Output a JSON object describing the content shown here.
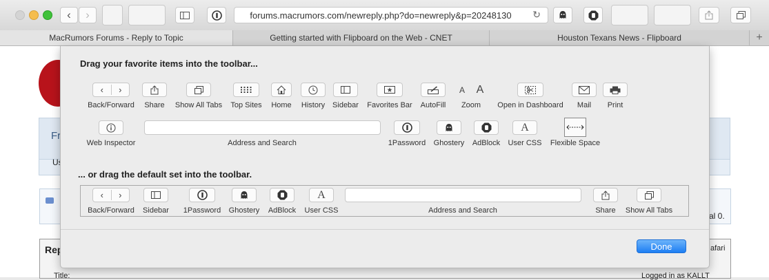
{
  "browser": {
    "url": "forums.macrumors.com/newreply.php?do=newreply&p=20248130",
    "tabs": [
      {
        "label": "MacRumors Forums - Reply to Topic",
        "active": true
      },
      {
        "label": "Getting started with Flipboard on the Web - CNET",
        "active": false
      },
      {
        "label": "Houston Texans News - Flipboard",
        "active": false
      }
    ],
    "back_glyph": "‹",
    "forward_glyph": "›",
    "reload_glyph": "↻",
    "new_tab_glyph": "+"
  },
  "background_page": {
    "fragment_1": "Fr",
    "fragment_2": "Us",
    "fragment_3": "al 0.",
    "fragment_4": "Rep",
    "fragment_5": "afari",
    "fragment_6": "Title:",
    "fragment_7": "Logged in as KALLT"
  },
  "sheet": {
    "favorites_heading": "Drag your favorite items into the toolbar...",
    "default_heading": "... or drag the default set into the toolbar.",
    "done_label": "Done",
    "favorites": {
      "back_forward": "Back/Forward",
      "share": "Share",
      "show_all_tabs": "Show All Tabs",
      "top_sites": "Top Sites",
      "home": "Home",
      "history": "History",
      "sidebar": "Sidebar",
      "favorites_bar": "Favorites Bar",
      "autofill": "AutoFill",
      "zoom": "Zoom",
      "open_in_dashboard": "Open in Dashboard",
      "mail": "Mail",
      "print": "Print",
      "web_inspector": "Web Inspector",
      "address_and_search": "Address and Search",
      "onepassword": "1Password",
      "ghostery": "Ghostery",
      "adblock": "AdBlock",
      "user_css": "User CSS",
      "flexible_space": "Flexible Space"
    },
    "zoom_small_glyph": "A",
    "zoom_large_glyph": "A",
    "user_css_glyph": "A",
    "default_set": {
      "back_forward": "Back/Forward",
      "sidebar": "Sidebar",
      "onepassword": "1Password",
      "ghostery": "Ghostery",
      "adblock": "AdBlock",
      "user_css": "User CSS",
      "address_and_search": "Address and Search",
      "share": "Share",
      "show_all_tabs": "Show All Tabs"
    }
  },
  "colors": {
    "accent": "#1d7ef3",
    "link": "#1a5fb4"
  }
}
